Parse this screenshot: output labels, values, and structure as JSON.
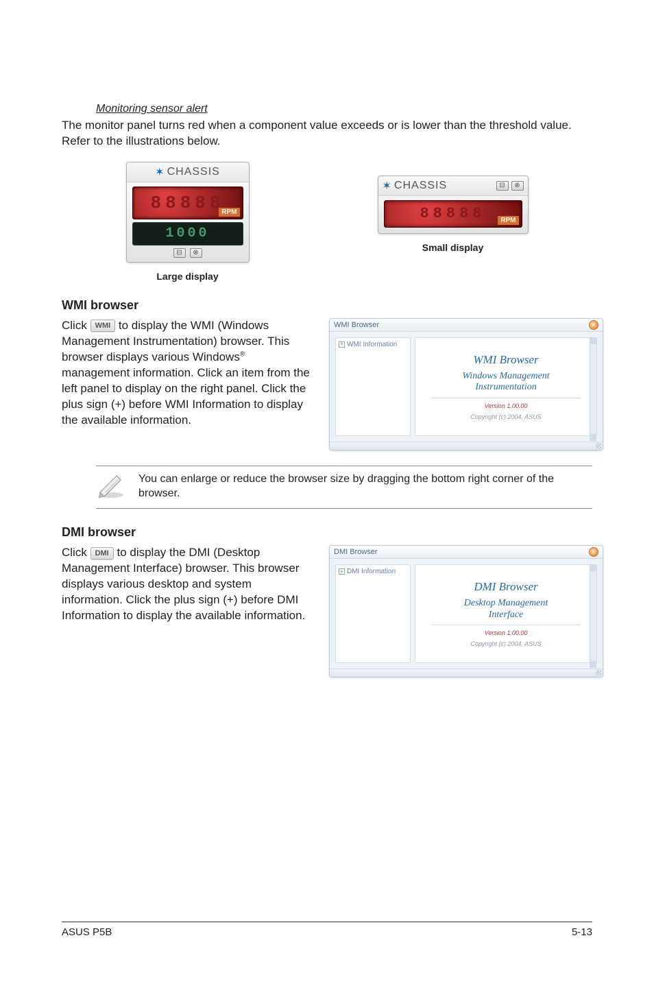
{
  "sensor_alert": {
    "italic_heading": "Monitoring sensor alert",
    "paragraph": "The monitor panel turns red when a component value exceeds or is lower than the threshold value. Refer to the illustrations below.",
    "large": {
      "title": "CHASSIS",
      "lcd_digits": "1000",
      "rpm": "RPM",
      "caption": "Large display"
    },
    "small": {
      "title": "CHASSIS",
      "lcd_digits": "88888",
      "rpm": "RPM",
      "caption": "Small display"
    }
  },
  "wmi": {
    "heading": "WMI browser",
    "button_label": "WMI",
    "text_before": "Click ",
    "text_after": " to display the WMI (Windows Management Instrumentation) browser. This browser displays various Windows",
    "super": "®",
    "text_tail": " management information. Click an item from the left panel to display on the right panel. Click the plus sign (+) before WMI Information to display the available information.",
    "window": {
      "title": "WMI Browser",
      "tree_item": "WMI Information",
      "content_title": "WMI Browser",
      "content_sub": "Windows Management\nInstrumentation",
      "version": "Version 1.00.00",
      "copyright": "Copyright (c) 2004, ASUS"
    }
  },
  "note": {
    "text": "You can enlarge or reduce the browser size by dragging the bottom right corner of the browser."
  },
  "dmi": {
    "heading": "DMI browser",
    "button_label": "DMI",
    "text_before": "Click ",
    "text_after": " to display the DMI (Desktop Management Interface) browser. This browser displays various desktop and system information. Click the plus sign (+) before DMI Information to display the available information.",
    "window": {
      "title": "DMI Browser",
      "tree_item": "DMI Information",
      "content_title": "DMI Browser",
      "content_sub": "Desktop Management\nInterface",
      "version": "Version 1.00.00",
      "copyright": "Copyright (c) 2004, ASUS"
    }
  },
  "footer": {
    "left": "ASUS P5B",
    "right": "5-13"
  }
}
